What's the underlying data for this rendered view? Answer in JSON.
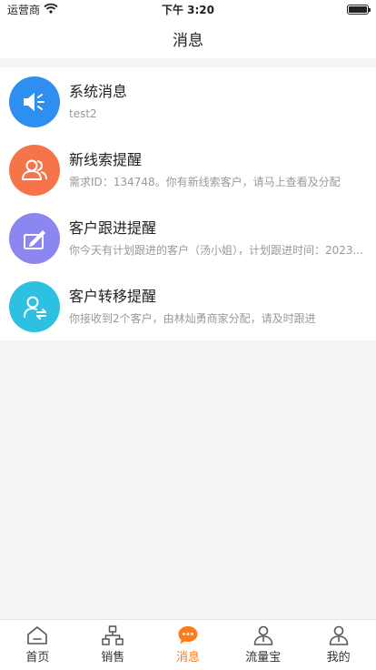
{
  "status": {
    "carrier": "运营商",
    "time": "下午 3:20"
  },
  "header": {
    "title": "消息"
  },
  "messages": [
    {
      "title": "系统消息",
      "desc": "test2",
      "icon": "speaker-icon",
      "color": "#2f8ff0"
    },
    {
      "title": "新线索提醒",
      "desc": "需求ID：134748。你有新线索客户，请马上查看及分配",
      "icon": "people-icon",
      "color": "#f5744a"
    },
    {
      "title": "客户跟进提醒",
      "desc": "你今天有计划跟进的客户（汤小姐），计划跟进时间：2023...",
      "icon": "pen-icon",
      "color": "#8c86f0"
    },
    {
      "title": "客户转移提醒",
      "desc": "你接收到2个客户，由林灿勇商家分配，请及时跟进",
      "icon": "user-transfer-icon",
      "color": "#2ec0e0"
    }
  ],
  "tabs": [
    {
      "label": "首页",
      "icon": "home-icon",
      "active": false
    },
    {
      "label": "销售",
      "icon": "org-chart-icon",
      "active": false
    },
    {
      "label": "消息",
      "icon": "chat-bubble-icon",
      "active": true
    },
    {
      "label": "流量宝",
      "icon": "user-icon",
      "active": false
    },
    {
      "label": "我的",
      "icon": "user-icon",
      "active": false
    }
  ],
  "colors": {
    "accent": "#ff7a1a"
  }
}
